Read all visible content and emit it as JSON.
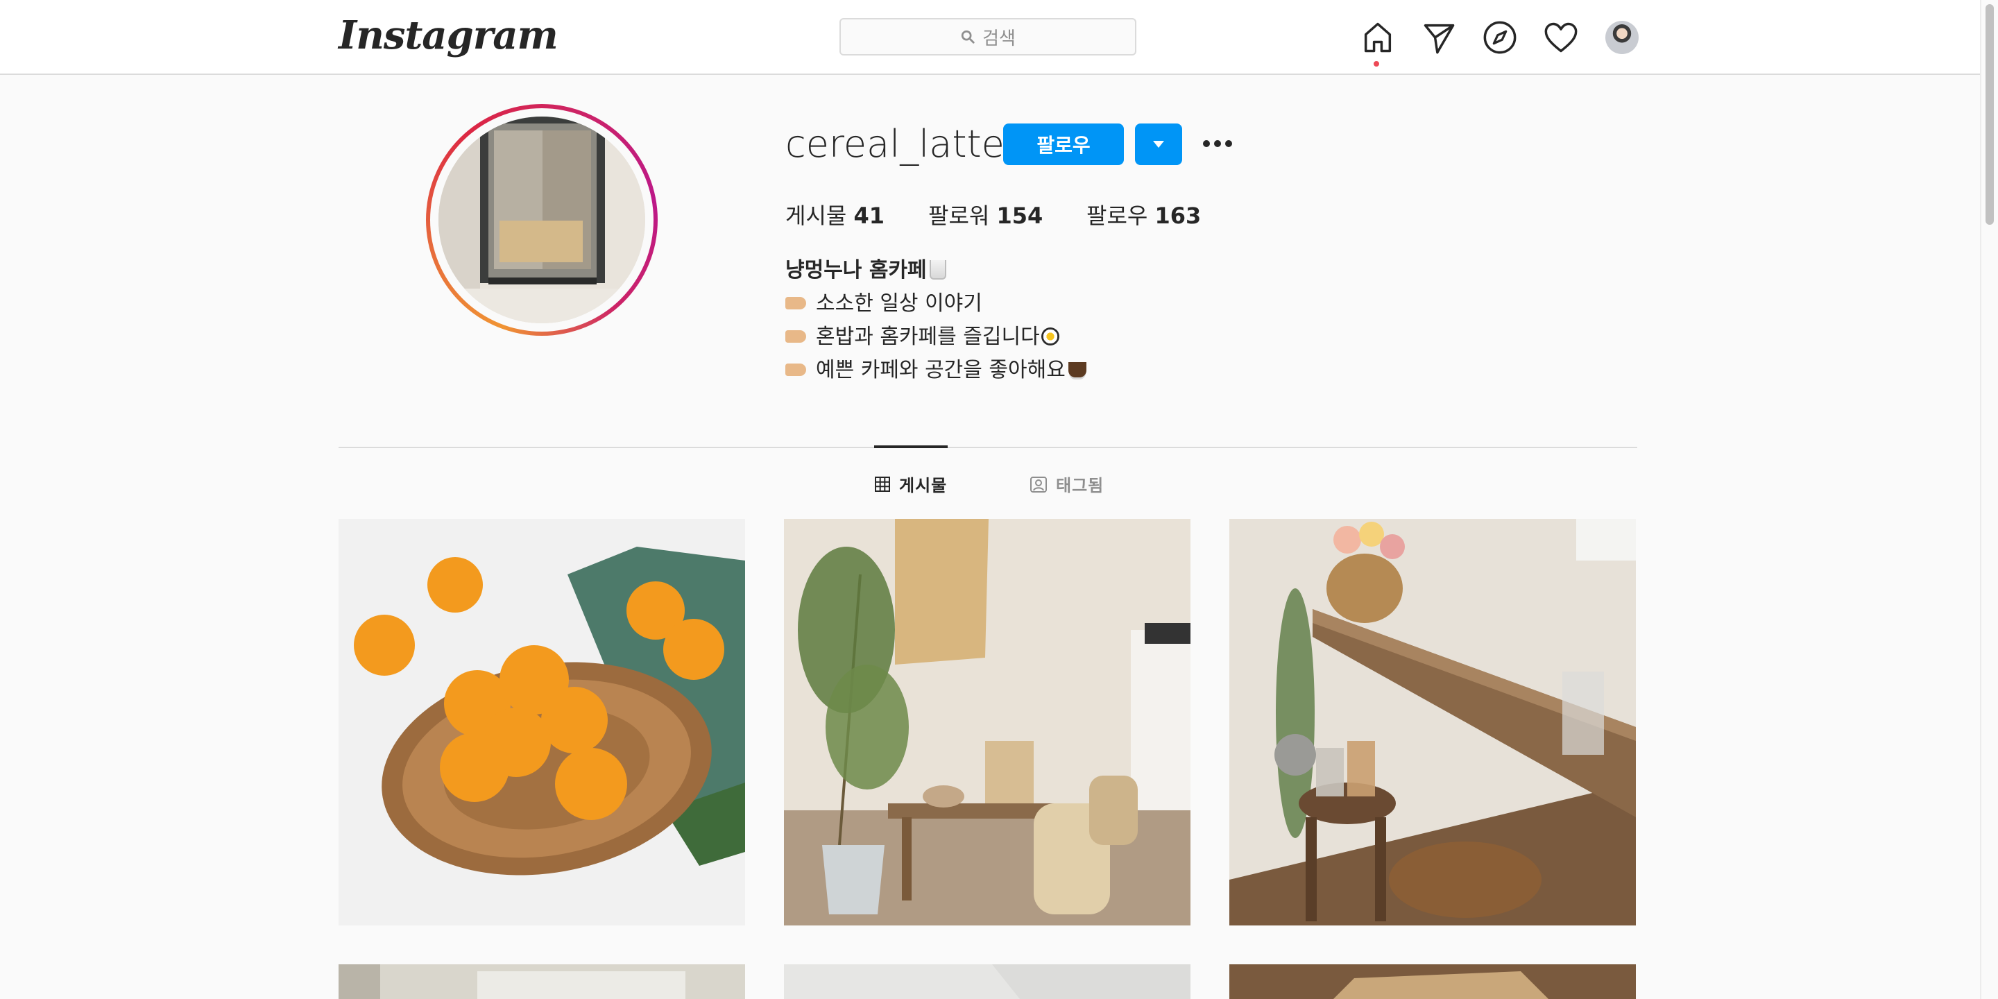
{
  "nav": {
    "logo": "Instagram",
    "search_placeholder": "검색",
    "icons": [
      "home-icon",
      "direct-icon",
      "explore-icon",
      "activity-heart-icon",
      "profile-avatar"
    ]
  },
  "profile": {
    "username": "cereal_latte",
    "follow_label": "팔로우",
    "stats": [
      {
        "label": "게시물",
        "value": "41"
      },
      {
        "label": "팔로워",
        "value": "154"
      },
      {
        "label": "팔로우",
        "value": "163"
      }
    ],
    "bio": {
      "name": "냥멍누나 홈카페",
      "lines": [
        "소소한 일상 이야기",
        "혼밥과 홈카페를 즐깁니다",
        "예쁜 카페와 공간을 좋아해요"
      ]
    }
  },
  "tabs": [
    {
      "label": "게시물",
      "active": true
    },
    {
      "label": "태그됨",
      "active": false
    }
  ],
  "colors": {
    "accent": "#0095f6",
    "text": "#262626",
    "muted": "#8e8e8e",
    "border": "#dbdbdb",
    "background": "#fafafa",
    "notification": "#ed4956"
  }
}
